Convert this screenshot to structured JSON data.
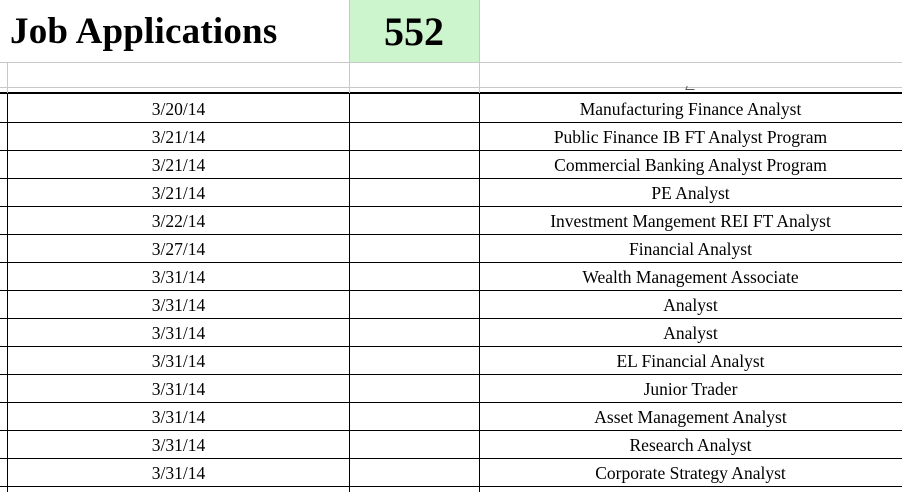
{
  "header": {
    "title": "Job Applications",
    "count": "552"
  },
  "colors": {
    "count_cell_fill": "#cdf5cd",
    "grid": "#c8c8c8",
    "border": "#000000"
  },
  "rows": [
    {
      "date": "3/20/14",
      "title": "Manufacturing Finance Analyst"
    },
    {
      "date": "3/21/14",
      "title": "Public Finance IB FT Analyst Program"
    },
    {
      "date": "3/21/14",
      "title": "Commercial Banking Analyst Program"
    },
    {
      "date": "3/21/14",
      "title": "PE Analyst"
    },
    {
      "date": "3/22/14",
      "title": "Investment Mangement REI FT Analyst"
    },
    {
      "date": "3/27/14",
      "title": "Financial Analyst"
    },
    {
      "date": "3/31/14",
      "title": "Wealth Management Associate"
    },
    {
      "date": "3/31/14",
      "title": "Analyst"
    },
    {
      "date": "3/31/14",
      "title": "Analyst"
    },
    {
      "date": "3/31/14",
      "title": "EL Financial Analyst"
    },
    {
      "date": "3/31/14",
      "title": "Junior Trader"
    },
    {
      "date": "3/31/14",
      "title": "Asset Management Analyst"
    },
    {
      "date": "3/31/14",
      "title": "Research Analyst"
    },
    {
      "date": "3/31/14",
      "title": "Corporate Strategy Analyst"
    }
  ]
}
